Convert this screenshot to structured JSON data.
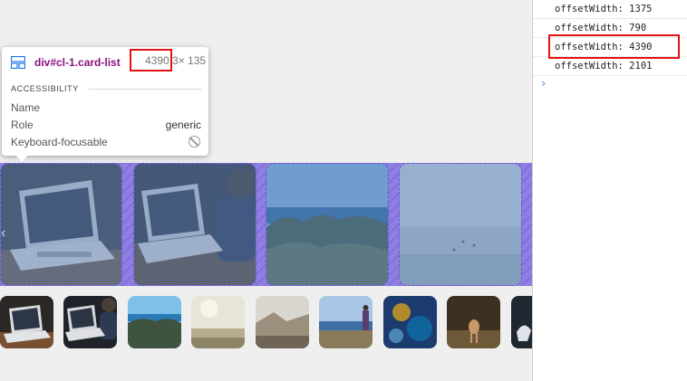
{
  "tooltip": {
    "selector": "div#cl-1.card-list",
    "width_text": "4390.3",
    "height_text": "× 135",
    "section_title": "ACCESSIBILITY",
    "rows": [
      {
        "label": "Name",
        "value": ""
      },
      {
        "label": "Role",
        "value": "generic"
      },
      {
        "label": "Keyboard-focusable",
        "value": ""
      }
    ],
    "icon": "grid-layout-icon",
    "keyboard_icon": "not-allowed-icon"
  },
  "console": {
    "lines": [
      "offsetWidth: 1375",
      "offsetWidth: 790",
      "offsetWidth: 4390",
      "offsetWidth: 2101"
    ],
    "prompt": "›"
  },
  "colors": {
    "highlight": "#e21212",
    "selector": "#881280",
    "overlay": "#8f7fe0"
  }
}
